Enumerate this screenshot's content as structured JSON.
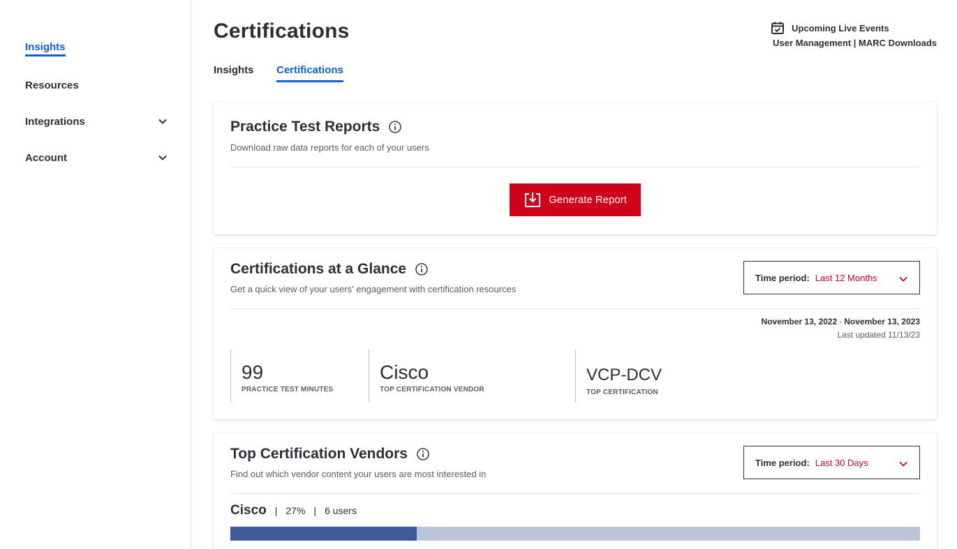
{
  "sidebar": {
    "items": [
      {
        "label": "Insights",
        "active": true,
        "expandable": false
      },
      {
        "label": "Resources",
        "active": false,
        "expandable": false
      },
      {
        "label": "Integrations",
        "active": false,
        "expandable": true
      },
      {
        "label": "Account",
        "active": false,
        "expandable": true
      }
    ]
  },
  "header": {
    "title": "Certifications",
    "tabs": [
      {
        "label": "Insights",
        "active": false
      },
      {
        "label": "Certifications",
        "active": true
      }
    ],
    "links": {
      "events": "Upcoming Live Events",
      "user_management": "User Management",
      "separator": "|",
      "marc_downloads": "MARC Downloads"
    }
  },
  "practice_reports": {
    "title": "Practice Test Reports",
    "subtitle": "Download raw data reports for each of your users",
    "button_label": "Generate Report"
  },
  "glance": {
    "title": "Certifications at a Glance",
    "subtitle": "Get a quick view of your users' engagement with certification resources",
    "time_period_label": "Time period:",
    "time_period_value": "Last 12 Months",
    "date_start": "November 13, 2022",
    "date_sep": "-",
    "date_end": "November 13, 2023",
    "last_updated": "Last updated 11/13/23",
    "stats": [
      {
        "value": "99",
        "caption": "PRACTICE TEST MINUTES"
      },
      {
        "value": "Cisco",
        "caption": "TOP CERTIFICATION VENDOR"
      },
      {
        "value": "VCP-DCV",
        "caption": "TOP CERTIFICATION"
      }
    ]
  },
  "vendors": {
    "title": "Top Certification Vendors",
    "subtitle": "Find out which vendor content your users are most interested in",
    "time_period_label": "Time period:",
    "time_period_value": "Last 30 Days",
    "pipe": "|",
    "list": [
      {
        "name": "Cisco",
        "percent_label": "27%",
        "users_label": "6 users",
        "share": 0.27
      }
    ]
  },
  "colors": {
    "accent_blue": "#0f5fd6",
    "brand_red": "#d0021b",
    "bar_fill": "#3e5a98",
    "bar_track": "#bac5d8"
  }
}
